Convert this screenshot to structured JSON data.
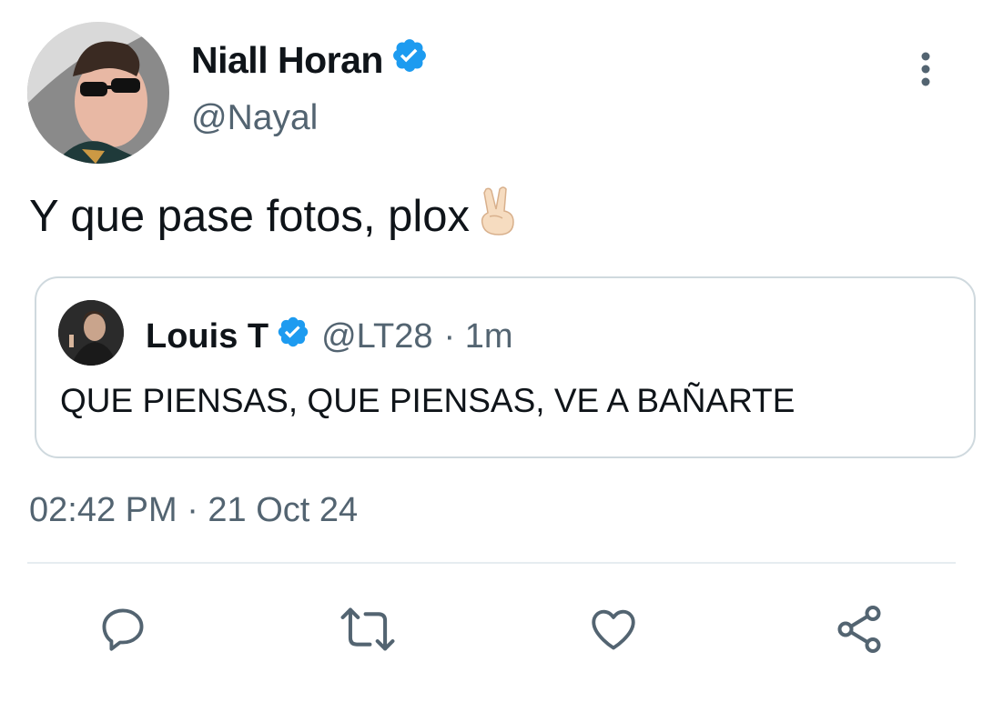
{
  "tweet": {
    "author": {
      "display_name": "Niall Horan",
      "handle": "@Nayal",
      "verified": true
    },
    "text": "Y que pase fotos, plox",
    "emoji": "victory-hand-emoji",
    "timestamp": "02:42 PM · 21 Oct 24"
  },
  "quoted_tweet": {
    "author": {
      "display_name": "Louis T",
      "handle": "@LT28",
      "time_ago": "· 1m",
      "verified": true
    },
    "text": "QUE PIENSAS, QUE PIENSAS, VE A BAÑARTE"
  },
  "actions": [
    {
      "icon": "reply-icon"
    },
    {
      "icon": "retweet-icon"
    },
    {
      "icon": "like-icon"
    },
    {
      "icon": "share-icon"
    }
  ],
  "colors": {
    "verified_blue": "#1d9bf0",
    "text_primary": "#0f1419",
    "text_secondary": "#536471",
    "border": "#cfd9de"
  }
}
